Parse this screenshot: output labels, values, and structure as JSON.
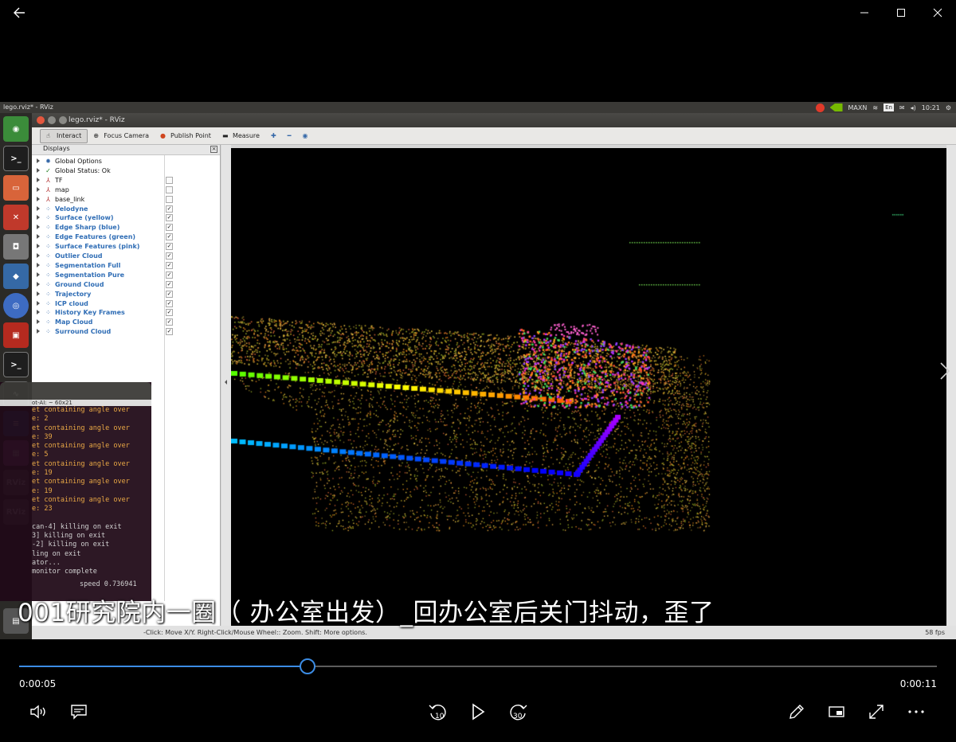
{
  "player": {
    "subtitle": "001研究院内一圈（ 办公室出发）_回办公室后关门抖动，歪了",
    "time_current": "0:00:05",
    "time_total": "0:00:11",
    "progress_fraction": 0.314,
    "accent": "#3c8ce4"
  },
  "desktop": {
    "window_title": "lego.rviz* - RViz",
    "tray": {
      "gpu": "MAXN",
      "lang": "En",
      "clock": "10:21"
    }
  },
  "rviz": {
    "title": "lego.rviz* - RViz",
    "toolbar": [
      "Interact",
      "Focus Camera",
      "Publish Point",
      "Measure"
    ],
    "panel_title": "Displays",
    "displays": [
      {
        "label": "Global Options",
        "blue": false,
        "check": null,
        "icon": "gear-icon"
      },
      {
        "label": "Global Status: Ok",
        "blue": false,
        "check": null,
        "icon": "check-icon"
      },
      {
        "label": "TF",
        "blue": false,
        "check": "",
        "icon": "axes-icon"
      },
      {
        "label": "map",
        "blue": false,
        "check": "",
        "icon": "axes-icon"
      },
      {
        "label": "base_link",
        "blue": false,
        "check": "",
        "icon": "axes-icon"
      },
      {
        "label": "Velodyne",
        "blue": true,
        "check": "✓",
        "icon": "pointcloud-icon"
      },
      {
        "label": "Surface (yellow)",
        "blue": true,
        "check": "✓",
        "icon": "pointcloud-icon"
      },
      {
        "label": "Edge Sharp (blue)",
        "blue": true,
        "check": "✓",
        "icon": "pointcloud-icon"
      },
      {
        "label": "Edge Features (green)",
        "blue": true,
        "check": "✓",
        "icon": "pointcloud-icon"
      },
      {
        "label": "Surface Features (pink)",
        "blue": true,
        "check": "✓",
        "icon": "pointcloud-icon"
      },
      {
        "label": "Outlier Cloud",
        "blue": true,
        "check": "✓",
        "icon": "pointcloud-icon"
      },
      {
        "label": "Segmentation Full",
        "blue": true,
        "check": "✓",
        "icon": "pointcloud-icon"
      },
      {
        "label": "Segmentation Pure",
        "blue": true,
        "check": "✓",
        "icon": "pointcloud-icon"
      },
      {
        "label": "Ground Cloud",
        "blue": true,
        "check": "✓",
        "icon": "pointcloud-icon"
      },
      {
        "label": "Trajectory",
        "blue": true,
        "check": "✓",
        "icon": "pointcloud-icon"
      },
      {
        "label": "ICP cloud",
        "blue": true,
        "check": "✓",
        "icon": "pointcloud-icon"
      },
      {
        "label": "History Key Frames",
        "blue": true,
        "check": "✓",
        "icon": "pointcloud-icon"
      },
      {
        "label": "Map Cloud",
        "blue": true,
        "check": "✓",
        "icon": "pointcloud-icon"
      },
      {
        "label": "Surround Cloud",
        "blue": true,
        "check": "✓",
        "icon": "pointcloud-icon"
      }
    ],
    "status_hint": "-Click: Move X/Y. Right-Click/Mouse Wheel:: Zoom. Shift: More options.",
    "fps": "58 fps"
  },
  "terminal": {
    "title": "ot-AI: ~ 60x21",
    "lines": [
      {
        "text": "et containing angle over",
        "color": "#e8a33a"
      },
      {
        "text": "e: 2",
        "color": "#e8a33a"
      },
      {
        "text": "et containing angle over",
        "color": "#e8a33a"
      },
      {
        "text": "e: 39",
        "color": "#e8a33a"
      },
      {
        "text": "et containing angle over",
        "color": "#e8a33a"
      },
      {
        "text": "e: 5",
        "color": "#e8a33a"
      },
      {
        "text": "et containing angle over",
        "color": "#e8a33a"
      },
      {
        "text": "e: 19",
        "color": "#e8a33a"
      },
      {
        "text": "et containing angle over",
        "color": "#e8a33a"
      },
      {
        "text": "e: 19",
        "color": "#e8a33a"
      },
      {
        "text": "et containing angle over",
        "color": "#e8a33a"
      },
      {
        "text": "e: 23",
        "color": "#e8a33a"
      },
      {
        "text": "",
        "color": "#cfcfcf"
      },
      {
        "text": "can-4] killing on exit",
        "color": "#cfcfcf"
      },
      {
        "text": "3] killing on exit",
        "color": "#cfcfcf"
      },
      {
        "text": "-2] killing on exit",
        "color": "#cfcfcf"
      },
      {
        "text": "ling on exit",
        "color": "#cfcfcf"
      },
      {
        "text": "ator...",
        "color": "#cfcfcf"
      },
      {
        "text": "monitor complete",
        "color": "#cfcfcf"
      }
    ],
    "bottom_text": "speed 0.736941"
  }
}
